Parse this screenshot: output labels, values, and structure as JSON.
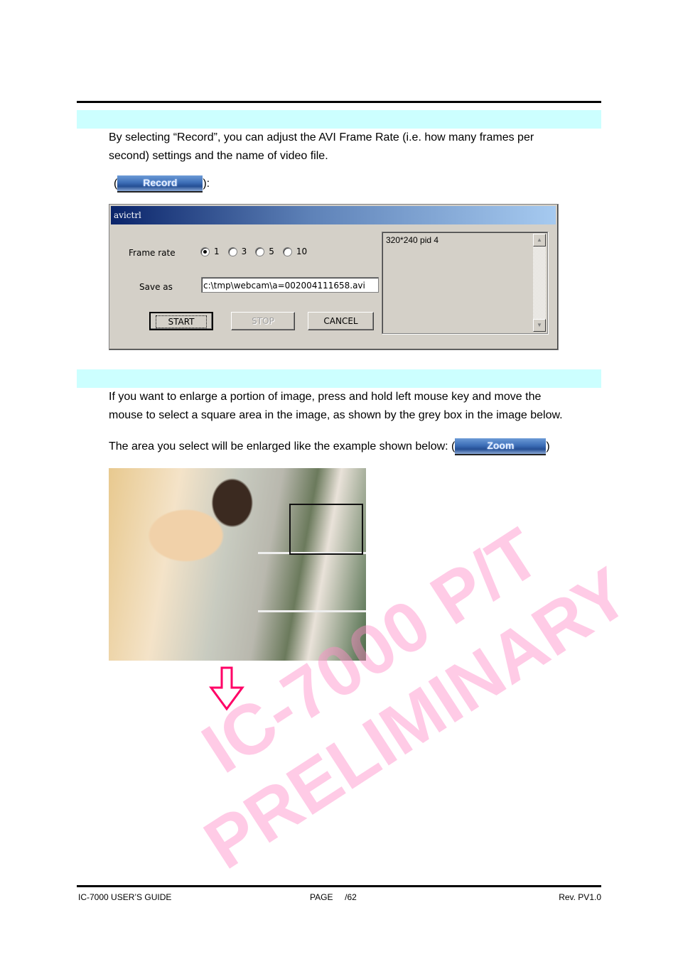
{
  "section_record": {
    "paragraph_line1": "By selecting “Record”, you can adjust the AVI Frame Rate (i.e. how many frames per",
    "paragraph_line2": "second) settings and the name of video file.",
    "button_prefix": "(",
    "button_label": "Record",
    "button_suffix": "):"
  },
  "dialog": {
    "title": "avictrl",
    "frame_rate_label": "Frame rate",
    "frame_rate_options": [
      "1",
      "3",
      "5",
      "10"
    ],
    "frame_rate_selected": "1",
    "save_as_label": "Save as",
    "save_as_value": "c:\\tmp\\webcam\\a=002004111658.avi",
    "start_label": "START",
    "stop_label": "STOP",
    "cancel_label": "CANCEL",
    "list_items": [
      "320*240 pid 4"
    ]
  },
  "section_zoom": {
    "paragraph_line1": "If you want to enlarge a portion of image, press and hold left mouse key and move the",
    "paragraph_line2": "mouse to select a square area in the image, as shown by the grey box in the image below.",
    "paragraph_line3": "The area you select will be enlarged like the example shown below: (",
    "button_label": "Zoom",
    "button_suffix": ")"
  },
  "watermark": {
    "line1": "IC-7000 P/T",
    "line2": "PRELIMINARY",
    "color": "#ff8cc8"
  },
  "arrow_color": "#ff0066",
  "footer": {
    "left": "IC-7000 USER’S GUIDE",
    "center": "PAGE     /62",
    "right": "Rev. PV1.0"
  }
}
